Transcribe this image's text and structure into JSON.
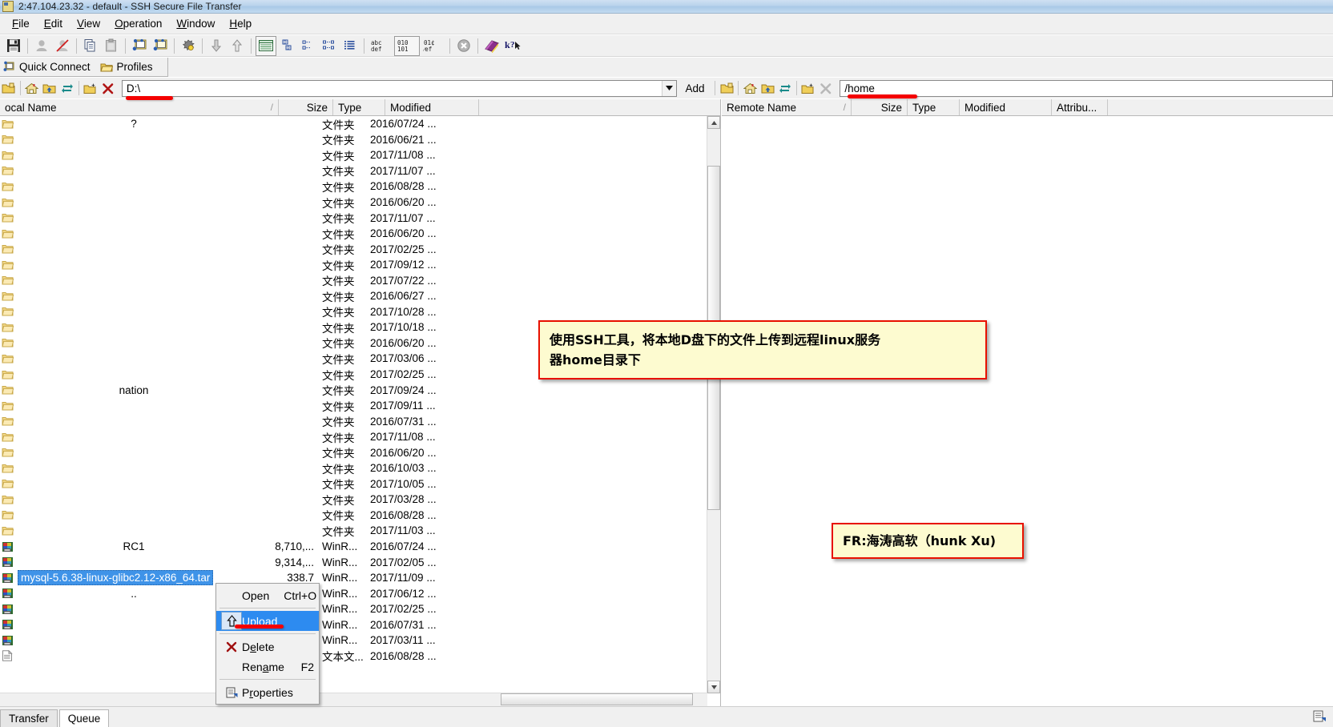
{
  "window": {
    "title": "2:47.104.23.32 - default - SSH Secure File Transfer",
    "icon": "app-icon"
  },
  "menubar": {
    "items": [
      {
        "label": "File",
        "mnemonic": "F"
      },
      {
        "label": "Edit",
        "mnemonic": "E"
      },
      {
        "label": "View",
        "mnemonic": "V"
      },
      {
        "label": "Operation",
        "mnemonic": "O"
      },
      {
        "label": "Window",
        "mnemonic": "W"
      },
      {
        "label": "Help",
        "mnemonic": "H"
      }
    ]
  },
  "toolbar": {
    "buttons": [
      {
        "name": "save-icon",
        "tip": "Save"
      },
      {
        "name": "connect-icon",
        "tip": "Connect"
      },
      {
        "name": "disconnect-icon",
        "tip": "Disconnect"
      },
      {
        "name": "copy-icon",
        "tip": "Copy"
      },
      {
        "name": "paste-icon",
        "tip": "Paste"
      },
      {
        "name": "new-file-transfer-window-icon",
        "tip": "New File Transfer Window"
      },
      {
        "name": "new-terminal-window-icon",
        "tip": "New Terminal Window"
      },
      {
        "name": "settings-icon",
        "tip": "Settings"
      },
      {
        "name": "download-arrow-icon",
        "tip": "Download"
      },
      {
        "name": "upload-arrow-icon",
        "tip": "Upload"
      },
      {
        "name": "toggle-remote-view-icon",
        "tip": "Show Remote"
      },
      {
        "name": "view-large-icons-icon",
        "tip": "Large Icons"
      },
      {
        "name": "view-small-icons-icon",
        "tip": "Small Icons"
      },
      {
        "name": "view-list-icon",
        "tip": "List"
      },
      {
        "name": "view-details-icon",
        "tip": "Details"
      },
      {
        "name": "ascii-transfer-icon",
        "tip": "ASCII",
        "glyph_top": "abc",
        "glyph_bottom": "def"
      },
      {
        "name": "binary-transfer-icon",
        "tip": "Binary",
        "glyph_top": "010",
        "glyph_bottom": "101"
      },
      {
        "name": "auto-transfer-icon",
        "tip": "Auto",
        "glyph_top": "01¢",
        "glyph_bottom": "%ef"
      },
      {
        "name": "stop-icon",
        "tip": "Stop"
      },
      {
        "name": "help-book-icon",
        "tip": "Help"
      },
      {
        "name": "context-help-icon",
        "tip": "Context Help"
      }
    ]
  },
  "connectbar": {
    "quick_connect": "Quick Connect",
    "profiles": "Profiles"
  },
  "local_nav": {
    "buttons": [
      {
        "name": "go-up-folder-icon"
      },
      {
        "name": "home-folder-icon"
      },
      {
        "name": "root-folder-icon"
      },
      {
        "name": "refresh-icon"
      },
      {
        "name": "new-folder-icon"
      },
      {
        "name": "delete-icon"
      }
    ],
    "path_value": "D:\\",
    "path_placeholder": "D:\\"
  },
  "remote_nav": {
    "add_label": "Add",
    "buttons": [
      {
        "name": "go-up-folder-icon"
      },
      {
        "name": "home-folder-icon"
      },
      {
        "name": "root-folder-icon"
      },
      {
        "name": "refresh-icon"
      },
      {
        "name": "new-folder-icon"
      },
      {
        "name": "delete-icon"
      }
    ],
    "path_value": "/home",
    "path_placeholder": "/home"
  },
  "local_pane": {
    "columns": [
      {
        "key": "name",
        "label": "ocal Name",
        "sort": "/"
      },
      {
        "key": "size",
        "label": "Size"
      },
      {
        "key": "type",
        "label": "Type"
      },
      {
        "key": "modified",
        "label": "Modified"
      }
    ],
    "rows": [
      {
        "icon": "folder-icon",
        "name": "?",
        "size": "",
        "type": "文件夹",
        "modified": "2016/07/24 ..."
      },
      {
        "icon": "folder-icon",
        "name": "",
        "size": "",
        "type": "文件夹",
        "modified": "2016/06/21 ..."
      },
      {
        "icon": "folder-icon",
        "name": "",
        "size": "",
        "type": "文件夹",
        "modified": "2017/11/08 ..."
      },
      {
        "icon": "folder-icon",
        "name": "",
        "size": "",
        "type": "文件夹",
        "modified": "2017/11/07 ..."
      },
      {
        "icon": "folder-icon",
        "name": "",
        "size": "",
        "type": "文件夹",
        "modified": "2016/08/28 ..."
      },
      {
        "icon": "folder-icon",
        "name": "",
        "size": "",
        "type": "文件夹",
        "modified": "2016/06/20 ..."
      },
      {
        "icon": "folder-icon",
        "name": "",
        "size": "",
        "type": "文件夹",
        "modified": "2017/11/07 ..."
      },
      {
        "icon": "folder-icon",
        "name": "",
        "size": "",
        "type": "文件夹",
        "modified": "2016/06/20 ..."
      },
      {
        "icon": "folder-icon",
        "name": "",
        "size": "",
        "type": "文件夹",
        "modified": "2017/02/25 ..."
      },
      {
        "icon": "folder-icon",
        "name": "",
        "size": "",
        "type": "文件夹",
        "modified": "2017/09/12 ..."
      },
      {
        "icon": "folder-icon",
        "name": "",
        "size": "",
        "type": "文件夹",
        "modified": "2017/07/22 ..."
      },
      {
        "icon": "folder-icon",
        "name": "",
        "size": "",
        "type": "文件夹",
        "modified": "2016/06/27 ..."
      },
      {
        "icon": "folder-icon",
        "name": "",
        "size": "",
        "type": "文件夹",
        "modified": "2017/10/28 ..."
      },
      {
        "icon": "folder-icon",
        "name": "",
        "size": "",
        "type": "文件夹",
        "modified": "2017/10/18 ..."
      },
      {
        "icon": "folder-icon",
        "name": "",
        "size": "",
        "type": "文件夹",
        "modified": "2016/06/20 ..."
      },
      {
        "icon": "folder-icon",
        "name": "",
        "size": "",
        "type": "文件夹",
        "modified": "2017/03/06 ..."
      },
      {
        "icon": "folder-icon",
        "name": "",
        "size": "",
        "type": "文件夹",
        "modified": "2017/02/25 ..."
      },
      {
        "icon": "folder-icon",
        "name": "nation",
        "size": "",
        "type": "文件夹",
        "modified": "2017/09/24 ..."
      },
      {
        "icon": "folder-icon",
        "name": "",
        "size": "",
        "type": "文件夹",
        "modified": "2017/09/11 ..."
      },
      {
        "icon": "folder-icon",
        "name": "",
        "size": "",
        "type": "文件夹",
        "modified": "2016/07/31 ..."
      },
      {
        "icon": "folder-icon",
        "name": "",
        "size": "",
        "type": "文件夹",
        "modified": "2017/11/08 ..."
      },
      {
        "icon": "folder-icon",
        "name": "",
        "size": "",
        "type": "文件夹",
        "modified": "2016/06/20 ..."
      },
      {
        "icon": "folder-icon",
        "name": "",
        "size": "",
        "type": "文件夹",
        "modified": "2016/10/03 ..."
      },
      {
        "icon": "folder-icon",
        "name": "",
        "size": "",
        "type": "文件夹",
        "modified": "2017/10/05 ..."
      },
      {
        "icon": "folder-icon",
        "name": "",
        "size": "",
        "type": "文件夹",
        "modified": "2017/03/28 ..."
      },
      {
        "icon": "folder-icon",
        "name": "",
        "size": "",
        "type": "文件夹",
        "modified": "2016/08/28 ..."
      },
      {
        "icon": "folder-icon",
        "name": "",
        "size": "",
        "type": "文件夹",
        "modified": "2017/11/03 ..."
      },
      {
        "icon": "archive-icon",
        "name": "RC1",
        "size": "8,710,...",
        "type": "WinR...",
        "modified": "2016/07/24 ..."
      },
      {
        "icon": "archive-icon",
        "name": "",
        "size": "9,314,...",
        "type": "WinR...",
        "modified": "2017/02/05 ..."
      },
      {
        "icon": "archive-icon",
        "name": "mysql-5.6.38-linux-glibc2.12-x86_64.tar",
        "selected": true,
        "size": "338.7",
        "type": "WinR...",
        "modified": "2017/11/09 ..."
      },
      {
        "icon": "archive-icon",
        "name": "..",
        "size": "",
        "type": "WinR...",
        "modified": "2017/06/12 ..."
      },
      {
        "icon": "archive-icon",
        "name": "",
        "size": "",
        "type": "WinR...",
        "modified": "2017/02/25 ..."
      },
      {
        "icon": "archive-icon",
        "name": "",
        "size": "",
        "type": "WinR...",
        "modified": "2016/07/31 ..."
      },
      {
        "icon": "archive-icon",
        "name": "",
        "size": "",
        "type": "WinR...",
        "modified": "2017/03/11 ..."
      },
      {
        "icon": "textfile-icon",
        "name": "",
        "size": "",
        "type": "文本文...",
        "modified": "2016/08/28 ..."
      }
    ]
  },
  "remote_pane": {
    "columns": [
      {
        "key": "name",
        "label": "Remote Name",
        "sort": "/"
      },
      {
        "key": "size",
        "label": "Size"
      },
      {
        "key": "type",
        "label": "Type"
      },
      {
        "key": "modified",
        "label": "Modified"
      },
      {
        "key": "attributes",
        "label": "Attribu..."
      }
    ],
    "rows": []
  },
  "context_menu": {
    "items": [
      {
        "id": "open",
        "label": "Open",
        "accel": "Ctrl+O",
        "icon": "",
        "highlighted": false
      },
      {
        "id": "sep1",
        "separator": true
      },
      {
        "id": "upload",
        "label": "Upload",
        "accel": "",
        "icon": "upload-arrow-icon",
        "highlighted": true
      },
      {
        "id": "sep2",
        "separator": true
      },
      {
        "id": "delete",
        "label": "Delete",
        "accel": "",
        "icon": "red-x-icon",
        "highlighted": false
      },
      {
        "id": "rename",
        "label": "Rename",
        "accel": "F2",
        "icon": "",
        "highlighted": false
      },
      {
        "id": "sep3",
        "separator": true
      },
      {
        "id": "properties",
        "label": "Properties",
        "accel": "",
        "icon": "properties-icon",
        "highlighted": false
      }
    ]
  },
  "annotations": [
    {
      "id": "instruction-note",
      "lines": [
        "使用SSH工具，将本地D盘下的文件上传到远程linux服务",
        "器home目录下"
      ]
    },
    {
      "id": "author-note",
      "lines": [
        "FR:海涛高软（hunk Xu)"
      ]
    }
  ],
  "bottom_tabs": [
    {
      "label": "Transfer",
      "active": false
    },
    {
      "label": "Queue",
      "active": true
    }
  ],
  "colors": {
    "annotation_border": "#e81000",
    "annotation_bg": "#fdfbd0",
    "selection_blue": "#3f93e8",
    "menu_highlight": "#2d8bf0",
    "red_marker": "#f40000",
    "titlebar_blue": "#a8c8e6"
  }
}
